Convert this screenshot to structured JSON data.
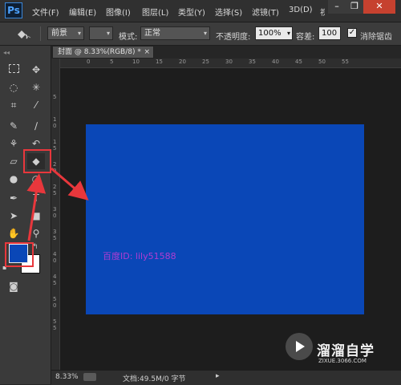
{
  "app": {
    "logo": "Ps"
  },
  "menu": [
    "文件(F)",
    "编辑(E)",
    "图像(I)",
    "图层(L)",
    "类型(Y)",
    "选择(S)",
    "滤镜(T)",
    "3D(D)",
    "视"
  ],
  "window_controls": {
    "minimize": "–",
    "restore": "❐",
    "close": "✕"
  },
  "options": {
    "fill_source": "前景",
    "mode_label": "模式:",
    "mode_value": "正常",
    "opacity_label": "不透明度:",
    "opacity_value": "100%",
    "tolerance_label": "容差:",
    "tolerance_value": "100",
    "antialias_label": "消除锯齿",
    "antialias_checked": true
  },
  "document": {
    "tab_title": "封面 @ 8.33%(RGB/8) *",
    "close": "×"
  },
  "rulers": {
    "horizontal": [
      "0",
      "5",
      "10",
      "15",
      "20",
      "25",
      "30",
      "35",
      "40",
      "45",
      "50",
      "55"
    ],
    "vertical": [
      "5",
      "1 0",
      "1 5",
      "2 0",
      "2 5",
      "3 0",
      "3 5",
      "4 0",
      "4 5",
      "5 0",
      "5 5"
    ]
  },
  "canvas": {
    "color": "#0a47b7",
    "text": "百度ID: lily51588",
    "text_color": "#b03cd2"
  },
  "colors": {
    "foreground": "#0a47b7",
    "background": "#ffffff"
  },
  "status": {
    "zoom": "8.33%",
    "doc_info": "文档:49.5M/0 字节"
  },
  "watermark": {
    "title": "溜溜自学",
    "url": "ZIXUE.3066.COM"
  }
}
